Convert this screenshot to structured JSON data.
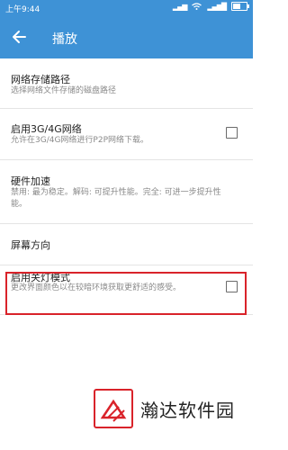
{
  "status_bar": {
    "time": "上午9:44",
    "battery_level": 0.55
  },
  "toolbar": {
    "title": "播放",
    "back_icon": "arrow-left-icon"
  },
  "settings": [
    {
      "title": "网络存储路径",
      "summary": "选择网络文件存储的磁盘路径",
      "has_checkbox": false,
      "checked": false
    },
    {
      "title": "启用3G/4G网络",
      "summary": "允许在3G/4G网络进行P2P网络下载。",
      "has_checkbox": true,
      "checked": false
    },
    {
      "title": "硬件加速",
      "summary": "禁用: 最为稳定。解码: 可提升性能。完全: 可进一步提升性能。",
      "has_checkbox": false,
      "checked": false
    },
    {
      "title": "屏幕方向",
      "summary": "",
      "has_checkbox": false,
      "checked": false
    },
    {
      "title": "启用关灯模式",
      "summary": "更改界面颜色以在较暗环境获取更舒适的感受。",
      "has_checkbox": true,
      "checked": false
    }
  ],
  "watermark": {
    "text": "瀚达软件园"
  },
  "colors": {
    "toolbar": "#3e92d6",
    "highlight": "#d9232a"
  }
}
